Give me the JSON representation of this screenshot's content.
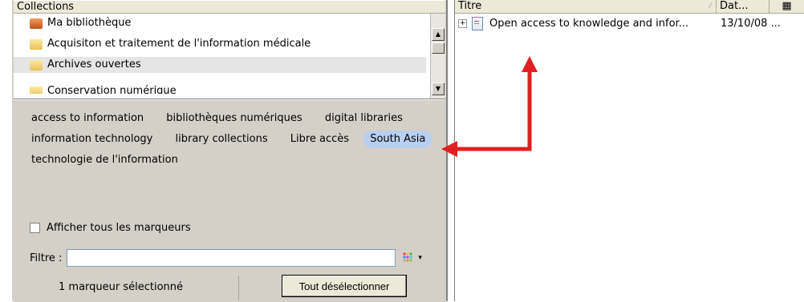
{
  "collections_panel": {
    "header": "Collections",
    "items": [
      {
        "label": "Ma bibliothèque",
        "icon": "library-icon"
      },
      {
        "label": "Acquisiton et traitement de l'information médicale",
        "icon": "folder-icon"
      },
      {
        "label": "Archives ouvertes",
        "icon": "folder-icon",
        "selected": true
      },
      {
        "label": "Conservation numérique",
        "icon": "folder-icon"
      }
    ]
  },
  "tags_panel": {
    "rows": [
      [
        "access to information",
        "bibliothèques numériques",
        "digital libraries"
      ],
      [
        "information technology",
        "library collections",
        "Libre accès",
        "South Asia"
      ],
      [
        "technologie de l'information"
      ]
    ],
    "highlighted_tag": "South Asia",
    "show_all_label": "Afficher tous les marqueurs",
    "filter_label": "Filtre :",
    "filter_value": "",
    "status": "1 marqueur sélectionné",
    "deselect_label": "Tout désélectionner"
  },
  "items_panel": {
    "columns": [
      "Titre",
      "Dat..."
    ],
    "rows": [
      {
        "title": "Open access to knowledge and infor...",
        "date": "13/10/08 ..."
      }
    ]
  },
  "colors": {
    "arrow": "#e02020",
    "tag_highlight": "#b9cff0"
  }
}
